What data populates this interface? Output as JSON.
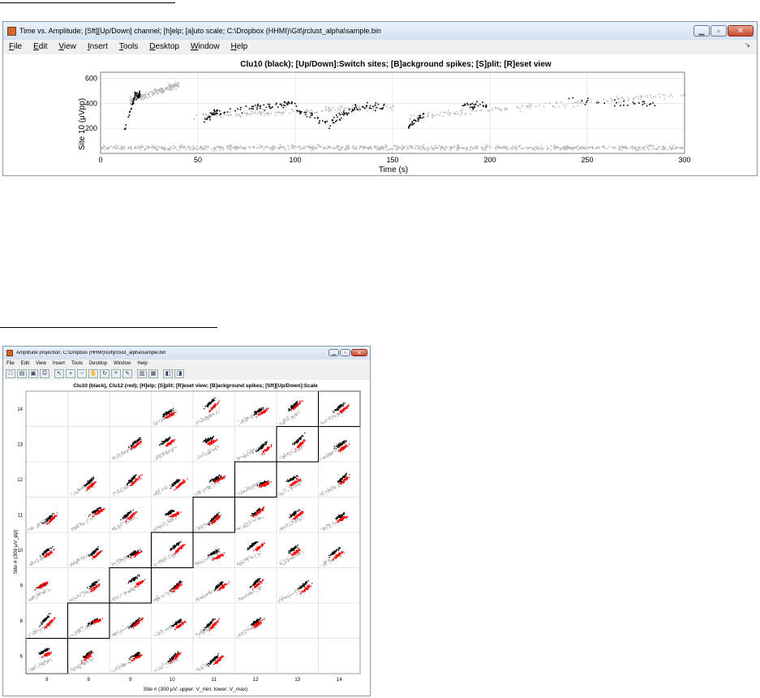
{
  "colors": {
    "background_spikes": "#b8b8b8",
    "clu10": "#000000",
    "clu12": "#ff0000",
    "axis": "#606060",
    "grid": "#e4e4e4"
  },
  "window1": {
    "title": "Time vs. Amplitude; [Sft][Up/Down] channel; [h]elp; [a]uto scale; C:\\Dropbox (HHMI)\\Git\\jrclust_alpha\\sample.bin",
    "menus": [
      {
        "first": "F",
        "rest": "ile"
      },
      {
        "first": "E",
        "rest": "dit"
      },
      {
        "first": "V",
        "rest": "iew"
      },
      {
        "first": "I",
        "rest": "nsert"
      },
      {
        "first": "T",
        "rest": "ools"
      },
      {
        "first": "D",
        "rest": "esktop"
      },
      {
        "first": "W",
        "rest": "indow"
      },
      {
        "first": "H",
        "rest": "elp"
      }
    ],
    "menu_arrow": "↘",
    "plot_title": "Clu10 (black); [Up/Down]:Switch sites; [B]ackground spikes; [S]plit; [R]eset view",
    "ylabel": "Site 10 (μVpp)",
    "xlabel": "Time (s)",
    "icons": {
      "app": "matlab-figure-icon"
    }
  },
  "window2": {
    "title": "Amplitude projection: C:\\Dropbox (HHMI)\\Git\\jrclust_alpha\\sample.bin",
    "menus": [
      "File",
      "Edit",
      "View",
      "Insert",
      "Tools",
      "Desktop",
      "Window",
      "Help"
    ],
    "toolbar_icons": [
      "new-figure-icon",
      "open-file-icon",
      "save-icon",
      "print-icon",
      "pointer-icon",
      "zoom-in-icon",
      "zoom-out-icon",
      "pan-icon",
      "rotate-icon",
      "data-cursor-icon",
      "brush-icon",
      "colorbar-icon",
      "legend-icon",
      "hide-plot-tools-icon",
      "show-plot-tools-icon"
    ],
    "plot_title": "Clu10 (black), Clu12 (red); [H]elp; [S]plit; [R]eset view; [B]ackground spikes; [Sft][Up/Down]:Scale",
    "ylabel": "Site # (300 μV_pp)",
    "xlabel": "Site # (300 μV; upper: V_min; lower: V_max)"
  },
  "chart_data": [
    {
      "type": "scatter",
      "title": "Clu10 (black); [Up/Down]:Switch sites; [B]ackground spikes; [S]plit; [R]eset view",
      "xlabel": "Time (s)",
      "ylabel": "Site 10 (μVpp)",
      "xlim": [
        0,
        300
      ],
      "ylim": [
        0,
        650
      ],
      "xticks": [
        0,
        50,
        100,
        150,
        200,
        250,
        300
      ],
      "yticks": [
        200,
        400,
        600
      ],
      "grid": true,
      "series": [
        {
          "name": "Clu10 (black)",
          "color": "#000000",
          "segments": [
            {
              "t": [
                12,
                18
              ],
              "y": [
                200,
                500
              ]
            },
            {
              "t": [
                18,
                20
              ],
              "y": [
                470,
                470
              ]
            },
            {
              "t": [
                53,
                60
              ],
              "y": [
                280,
                340
              ]
            },
            {
              "t": [
                60,
                85
              ],
              "y": [
                340,
                380
              ]
            },
            {
              "t": [
                85,
                100
              ],
              "y": [
                380,
                410
              ]
            },
            {
              "t": [
                100,
                118
              ],
              "y": [
                360,
                230
              ]
            },
            {
              "t": [
                118,
                130
              ],
              "y": [
                260,
                360
              ]
            },
            {
              "t": [
                130,
                146
              ],
              "y": [
                380,
                380
              ]
            },
            {
              "t": [
                158,
                166
              ],
              "y": [
                220,
                310
              ]
            },
            {
              "t": [
                185,
                198
              ],
              "y": [
                390,
                390
              ]
            },
            {
              "t": [
                240,
                288
              ],
              "y": [
                420,
                400
              ]
            }
          ]
        },
        {
          "color": "#b8b8b8",
          "segments": [
            {
              "t": [
                0,
                300
              ],
              "y": [
                50,
                50
              ]
            },
            {
              "t": [
                14,
                40
              ],
              "y": [
                420,
                560
              ]
            },
            {
              "t": [
                47,
                150
              ],
              "y": [
                300,
                380
              ]
            },
            {
              "t": [
                158,
                300
              ],
              "y": [
                300,
                480
              ]
            }
          ]
        }
      ]
    },
    {
      "type": "scatter",
      "title": "Clu10 (black), Clu12 (red); [H]elp; [S]plit; [R]eset view; [B]ackground spikes; [Sft][Up/Down]:Scale",
      "xlabel": "Site # (300 μV; upper: V_min; lower: V_max)",
      "ylabel": "Site # (300 μV_pp)",
      "x_sites": [
        8,
        9,
        9,
        10,
        11,
        12,
        13,
        14
      ],
      "y_sites": [
        14,
        13,
        12,
        11,
        10,
        9,
        8,
        6
      ],
      "xtick_labels": [
        "8",
        "8",
        "9",
        "10",
        "11",
        "12",
        "13",
        "14"
      ],
      "ytick_labels": [
        "14",
        "13",
        "12",
        "11",
        "10",
        "9",
        "8",
        "6"
      ],
      "highlighted_diagonal": true,
      "panels": "8 x 8 grid of amplitude projection scatter panels; grey = background spikes, black = Clu10, red = Clu12",
      "grid": true
    }
  ]
}
